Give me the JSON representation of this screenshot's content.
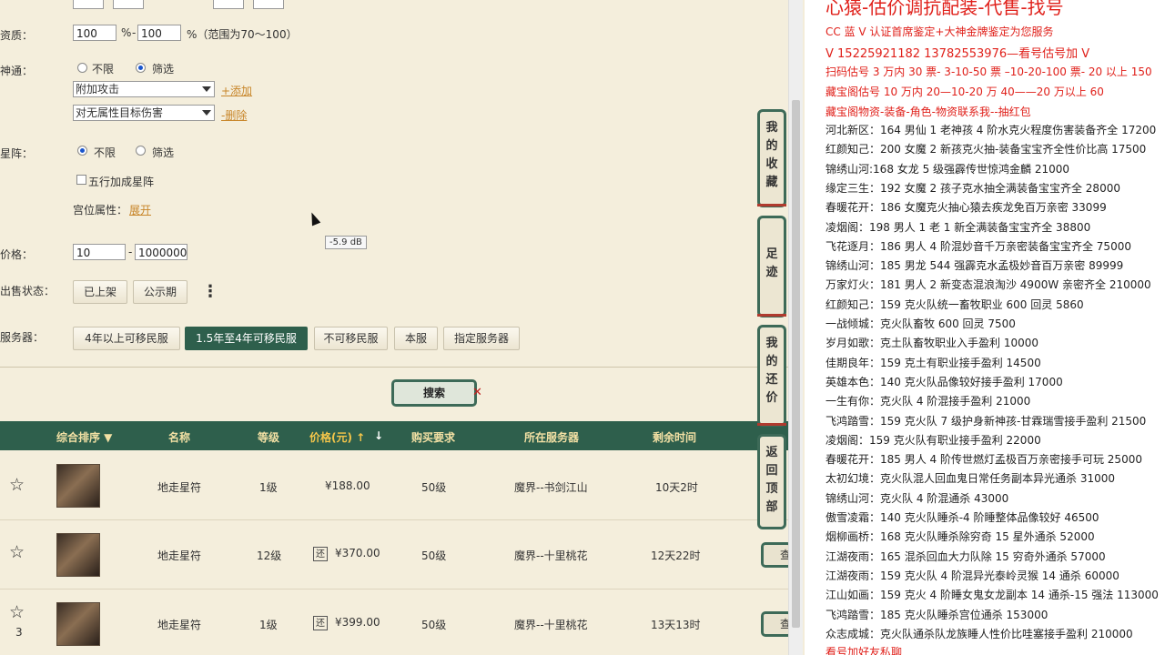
{
  "filters": {
    "zizhi": {
      "label": "资质：",
      "min": "100",
      "max": "100",
      "pct": "%",
      "dash": "-",
      "hint": "%（范围为70～100）"
    },
    "shentong": {
      "label": "神通：",
      "opt_none": "不限",
      "opt_filter": "筛选",
      "select1": "附加攻击",
      "add_link": "+添加",
      "select2": "对无属性目标伤害",
      "remove_link": "-删除"
    },
    "xingzhen": {
      "label": "星阵：",
      "opt_none": "不限",
      "opt_filter": "筛选",
      "wuxing": "五行加成星阵",
      "gongwei": "宫位属性：",
      "expand": "展开"
    },
    "price": {
      "label": "价格：",
      "min": "10",
      "dash": "-",
      "max": "1000000"
    },
    "sale_status": {
      "label": "出售状态：",
      "on_shelf": "已上架",
      "public": "公示期",
      "more": "⋮"
    },
    "server": {
      "label": "服务器：",
      "options": [
        "4年以上可移民服",
        "1.5年至4年可移民服",
        "不可移民服",
        "本服",
        "指定服务器"
      ],
      "active_index": 1
    }
  },
  "tooltip": "-5.9 dB",
  "search_label": "搜索",
  "table": {
    "headers": [
      "综合排序 ▼",
      "名称",
      "等级",
      "价格(元) ↑",
      "↓",
      "购买要求",
      "所在服务器",
      "剩余时间"
    ],
    "rows": [
      {
        "name": "地走星符",
        "level": "1级",
        "price": "¥188.00",
        "huan": "",
        "req": "50级",
        "server": "魔界--书剑江山",
        "time": "10天2时",
        "count": ""
      },
      {
        "name": "地走星符",
        "level": "12级",
        "price": "¥370.00",
        "huan": "还",
        "req": "50级",
        "server": "魔界--十里桃花",
        "time": "12天22时",
        "count": ""
      },
      {
        "name": "地走星符",
        "level": "1级",
        "price": "¥399.00",
        "huan": "还",
        "req": "50级",
        "server": "魔界--十里桃花",
        "time": "13天13时",
        "count": "3"
      }
    ],
    "check_label": "查"
  },
  "side_buttons": [
    {
      "chars": [
        "我",
        "的",
        "收",
        "藏"
      ]
    },
    {
      "chars": [
        "足",
        "迹"
      ]
    },
    {
      "chars": [
        "我",
        "的",
        "还",
        "价"
      ]
    },
    {
      "chars": [
        "返",
        "回",
        "顶",
        "部"
      ]
    }
  ],
  "right_panel": {
    "title": "心猿-估价调抗配装-代售-找号",
    "red_lines": [
      "CC 蓝 V 认证首席鉴定+大神金牌鉴定为您服务",
      "V 15225921182     13782553976—看号估号加 V",
      "扫码估号 3 万内 30 票- 3-10-50 票  –10-20-100 票- 20 以上 150",
      "藏宝阁估号 10 万内 20—10-20 万 40——20 万以上 60",
      "藏宝阁物资-装备-角色-物资联系我--抽红包"
    ],
    "lines": [
      "河北新区：164 男仙 1 老神孩 4 阶水克火程度伤害装备齐全 17200",
      "红颜知己：200 女魔 2 新孩克火抽-装备宝宝齐全性价比高 17500",
      "锦绣山河:168 女龙 5 级强霹传世惊鸿金麟 21000",
      "缘定三生：192 女魔 2 孩子克水抽全满装备宝宝齐全 28000",
      "春暖花开：186 女魔克火抽心猿去疾龙免百万亲密 33099",
      "凌烟阁：198 男人 1 老 1 新全满装备宝宝齐全 38800",
      "飞花逐月：186 男人 4 阶混妙音千万亲密装备宝宝齐全 75000",
      "锦绣山河：185 男龙 544 强霹克水孟极妙音百万亲密 89999",
      "万家灯火：181 男人 2 新变态混浪淘沙 4900W 亲密齐全 210000",
      "红颜知己：159 克火队统一畜牧职业 600 回灵 5860",
      "一战倾城：克火队畜牧 600 回灵 7500",
      "岁月如歌：克土队畜牧职业入手盈利 10000",
      "佳期良年：159 克土有职业接手盈利 14500",
      "英雄本色：140 克火队品像较好接手盈利 17000",
      "一生有你：克火队 4 阶混接手盈利 21000",
      "飞鸿踏雪：159 克火队 7 级护身新神孩-甘霖瑞雪接手盈利 21500",
      "凌烟阁：159 克火队有职业接手盈利 22000",
      "春暖花开：185 男人 4 阶传世燃灯孟极百万亲密接手可玩 25000",
      "太初幻境：克火队混人回血鬼日常任务副本异光通杀 31000",
      "锦绣山河：克火队 4 阶混通杀 43000",
      "傲雪凌霜：140 克火队睡杀-4 阶睡整体品像较好 46500",
      "烟柳画桥：168 克火队睡杀除穷奇 15 星外通杀 52000",
      "江湖夜雨：165 混杀回血大力队除 15 穷奇外通杀 57000",
      "江湖夜雨：159 克火队 4 阶混异光泰岭灵猴 14 通杀 60000",
      "江山如画：159 克火 4 阶睡女鬼女龙副本 14 通杀-15 强法 113000",
      "飞鸿踏雪：185 克火队睡杀宫位通杀 153000",
      "众志成城：克火队通杀队龙族睡人性价比哇塞接手盈利 210000"
    ],
    "footer": "看号加好友私聊"
  }
}
